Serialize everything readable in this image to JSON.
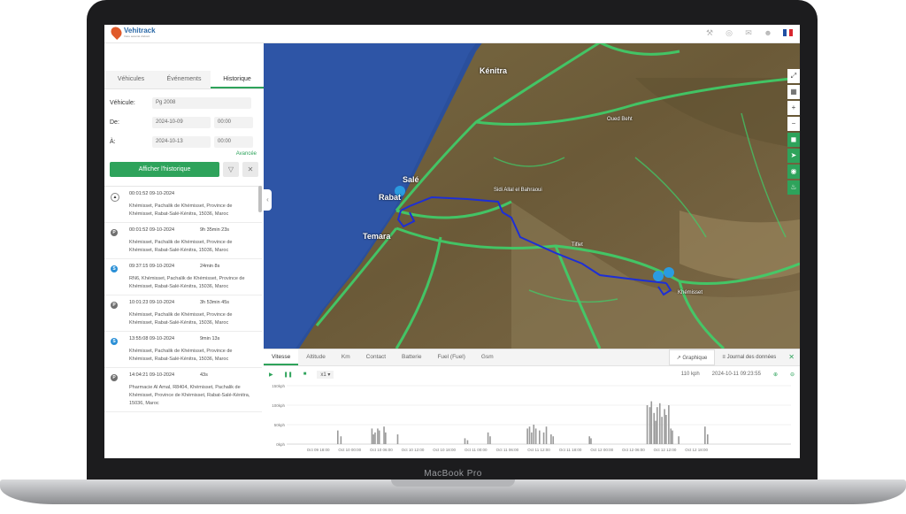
{
  "device": {
    "brand": "MacBook Pro"
  },
  "app": {
    "logo_name": "Vehitrack",
    "logo_tagline": "Votre sécurité d'abord",
    "top_icons": [
      "wrench-icon",
      "globe-icon",
      "chat-icon",
      "user-icon"
    ],
    "language_flag": {
      "code": "FR",
      "colors": [
        "#1f4fa3",
        "#ffffff",
        "#d8262f"
      ]
    }
  },
  "panel": {
    "tabs": [
      {
        "label": "Véhicules",
        "active": false
      },
      {
        "label": "Événements",
        "active": false
      },
      {
        "label": "Historique",
        "active": true
      }
    ],
    "form": {
      "vehicle_label": "Véhicule:",
      "vehicle_value": "Pg 2008",
      "from_label": "De:",
      "from_date": "2024-10-09",
      "from_time": "00:00",
      "to_label": "À:",
      "to_date": "2024-10-13",
      "to_time": "00:00",
      "advanced_link": "Avancée",
      "show_button": "Afficher l'historique"
    },
    "events": [
      {
        "badge": "▲",
        "badge_color": "#ffffff",
        "badge_text_color": "#333333",
        "time": "00:01:52 09-10-2024",
        "duration": "",
        "address": "Khémisset, Pachalik de Khémisset, Province de Khémisset, Rabat-Salé-Kénitra, 15036, Maroc"
      },
      {
        "badge": "P",
        "badge_color": "#6f6f6f",
        "badge_text_color": "#ffffff",
        "time": "00:01:52 09-10-2024",
        "duration": "9h 35min 23s",
        "address": "Khémisset, Pachalik de Khémisset, Province de Khémisset, Rabat-Salé-Kénitra, 15036, Maroc"
      },
      {
        "badge": "S",
        "badge_color": "#2a8fd6",
        "badge_text_color": "#ffffff",
        "time": "09:37:15 09-10-2024",
        "duration": "24min 8s",
        "address": "RN6, Khémisset, Pachalik de Khémisset, Province de Khémisset, Rabat-Salé-Kénitra, 15036, Maroc"
      },
      {
        "badge": "P",
        "badge_color": "#6f6f6f",
        "badge_text_color": "#ffffff",
        "time": "10:01:23 09-10-2024",
        "duration": "3h 53min 45s",
        "address": "Khémisset, Pachalik de Khémisset, Province de Khémisset, Rabat-Salé-Kénitra, 15036, Maroc"
      },
      {
        "badge": "S",
        "badge_color": "#2a8fd6",
        "badge_text_color": "#ffffff",
        "time": "13:55:08 09-10-2024",
        "duration": "9min 13s",
        "address": "Khémisset, Pachalik de Khémisset, Province de Khémisset, Rabat-Salé-Kénitra, 15036, Maroc"
      },
      {
        "badge": "P",
        "badge_color": "#6f6f6f",
        "badge_text_color": "#ffffff",
        "time": "14:04:21 09-10-2024",
        "duration": "43s",
        "address": "Pharmacie Al Amal, R8404, Khémisset, Pachalik de Khémisset, Province de Khémisset, Rabat-Salé-Kénitra, 15036, Maroc"
      }
    ]
  },
  "map": {
    "labels": [
      "Kénitra",
      "Salé",
      "Rabat",
      "Temara",
      "Khémisset",
      "Tiflet",
      "Sidi Allal el Bahraoui",
      "Oued Beht"
    ],
    "tools": [
      "fullscreen-icon",
      "layers-icon",
      "zoom-in-icon",
      "zoom-out-icon",
      "road-icon",
      "navigate-icon",
      "compass-icon",
      "bell-icon"
    ],
    "route_color": "#1d2fd6",
    "road_color": "#3fd06a"
  },
  "chart_panel": {
    "tabs": [
      {
        "label": "Vitesse",
        "active": true
      },
      {
        "label": "Altitude",
        "active": false
      },
      {
        "label": "Km",
        "active": false
      },
      {
        "label": "Contact",
        "active": false
      },
      {
        "label": "Batterie",
        "active": false
      },
      {
        "label": "Fuel (Fuel)",
        "active": false
      },
      {
        "label": "Gsm",
        "active": false
      }
    ],
    "view_tabs": {
      "graph": "Graphique",
      "journal": "Journal des données"
    },
    "playback_speed": "x1",
    "current_speed": "110 kph",
    "current_time": "2024-10-11 09:23:55"
  },
  "chart_data": {
    "type": "bar",
    "yunit": "kph",
    "y_ticks": [
      "150kph",
      "100kph",
      "50kph",
      "0kph"
    ],
    "x_ticks": [
      "Oct 09 18:00",
      "Oct 10 00:00",
      "Oct 10 06:00",
      "Oct 10 12:00",
      "Oct 10 18:00",
      "Oct 11 00:00",
      "Oct 11 06:00",
      "Oct 11 12:00",
      "Oct 11 18:00",
      "Oct 12 00:00",
      "Oct 12 06:00",
      "Oct 12 12:00",
      "Oct 12 18:00"
    ],
    "ylim": [
      0,
      150
    ],
    "x_range_hours": [
      0,
      96
    ],
    "values_hours": [
      9.6,
      10.2,
      16.1,
      16.4,
      16.7,
      17.2,
      17.5,
      18.4,
      18.7,
      21.0,
      33.8,
      34.3,
      38.2,
      38.6,
      45.7,
      46.1,
      46.5,
      46.9,
      47.3,
      48.0,
      48.8,
      49.3,
      50.2,
      50.6,
      57.5,
      57.8,
      68.5,
      69.0,
      69.3,
      69.8,
      70.1,
      70.4,
      70.9,
      71.3,
      71.8,
      72.1,
      72.6,
      73.0,
      73.3,
      74.5,
      79.5,
      80.0
    ],
    "values_kph": [
      35,
      20,
      40,
      25,
      30,
      40,
      35,
      45,
      30,
      25,
      15,
      10,
      30,
      20,
      40,
      45,
      30,
      50,
      40,
      35,
      30,
      45,
      25,
      20,
      20,
      15,
      100,
      95,
      110,
      80,
      60,
      95,
      105,
      70,
      90,
      75,
      100,
      40,
      35,
      20,
      45,
      25
    ]
  }
}
